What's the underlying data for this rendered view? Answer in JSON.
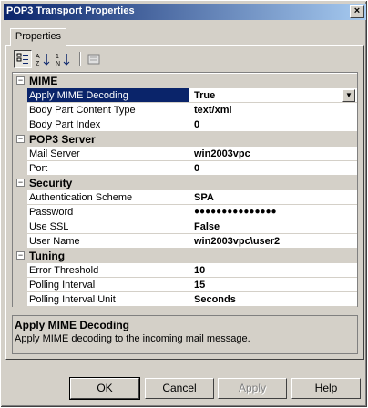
{
  "window": {
    "title": "POP3 Transport Properties",
    "close_glyph": "×"
  },
  "tab": {
    "label": "Properties"
  },
  "toolbar": [
    {
      "name": "categorized-view-icon",
      "pressed": true
    },
    {
      "name": "alphabetical-sort-icon",
      "pressed": false
    },
    {
      "name": "numeric-sort-icon",
      "pressed": false
    },
    {
      "name": "property-pages-icon",
      "pressed": false
    }
  ],
  "grid": {
    "mime": {
      "label": "MIME",
      "apply_decoding": {
        "name": "Apply MIME Decoding",
        "value": "True"
      },
      "content_type": {
        "name": "Body Part Content Type",
        "value": "text/xml"
      },
      "part_index": {
        "name": "Body Part Index",
        "value": "0"
      }
    },
    "server": {
      "label": "POP3 Server",
      "mail_server": {
        "name": "Mail Server",
        "value": "win2003vpc"
      },
      "port": {
        "name": "Port",
        "value": "0"
      }
    },
    "security": {
      "label": "Security",
      "auth": {
        "name": "Authentication Scheme",
        "value": "SPA"
      },
      "password": {
        "name": "Password",
        "value": "●●●●●●●●●●●●●●●"
      },
      "ssl": {
        "name": "Use SSL",
        "value": "False"
      },
      "user": {
        "name": "User Name",
        "value": "win2003vpc\\user2"
      }
    },
    "tuning": {
      "label": "Tuning",
      "err": {
        "name": "Error Threshold",
        "value": "10"
      },
      "interval": {
        "name": "Polling Interval",
        "value": "15"
      },
      "unit": {
        "name": "Polling Interval Unit",
        "value": "Seconds"
      }
    },
    "expander_glyph": "−",
    "dropdown_glyph": "▼"
  },
  "description": {
    "title": "Apply MIME Decoding",
    "text": "Apply MIME decoding to the incoming mail message."
  },
  "buttons": {
    "ok": "OK",
    "cancel": "Cancel",
    "apply": "Apply",
    "help": "Help"
  },
  "colors": {
    "selection": "#0a246a",
    "face": "#d4d0c8"
  }
}
